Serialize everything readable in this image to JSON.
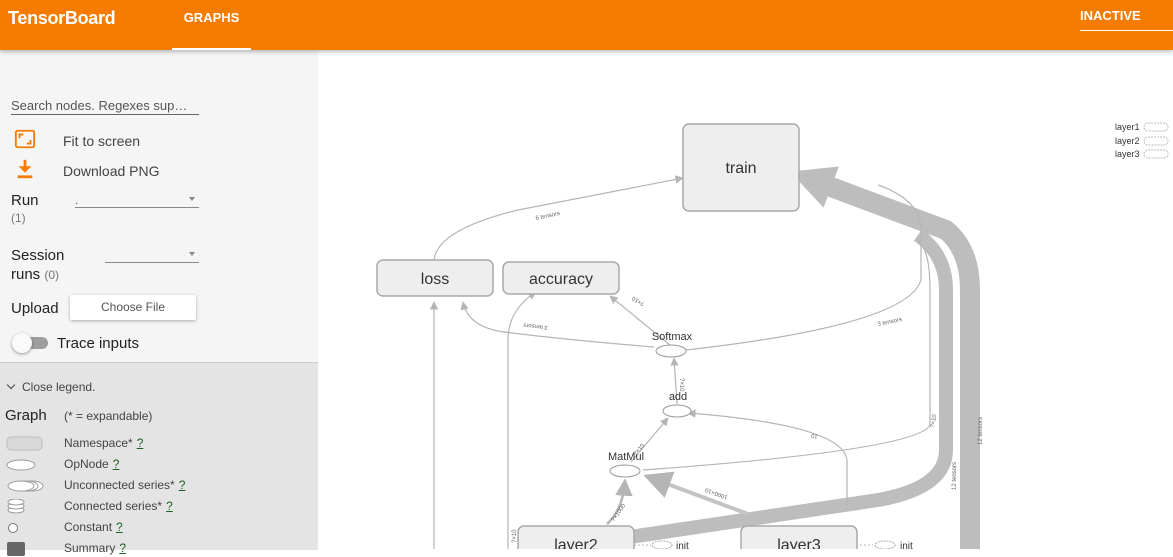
{
  "header": {
    "brand": "TensorBoard",
    "tab": "GRAPHS",
    "status": "INACTIVE",
    "color": "#f57c00"
  },
  "sidebar": {
    "search_placeholder": "Search nodes. Regexes sup…",
    "fit_label": "Fit to screen",
    "download_label": "Download PNG",
    "run_label": "Run",
    "run_count": "(1)",
    "run_value": ".",
    "session_label_1": "Session",
    "session_label_2": "runs",
    "session_count": "(0)",
    "upload_label": "Upload",
    "choose_file": "Choose File",
    "trace_label": "Trace inputs"
  },
  "legend": {
    "toggle": "Close legend.",
    "graph": "Graph",
    "expandable": "(* = expandable)",
    "help": "?",
    "items": [
      "Namespace*",
      "OpNode",
      "Unconnected series*",
      "Connected series*",
      "Constant",
      "Summary"
    ]
  },
  "graph": {
    "nodes": {
      "train": "train",
      "loss": "loss",
      "accuracy": "accuracy",
      "softmax": "Softmax",
      "add": "add",
      "matmul": "MatMul",
      "layer2": "layer2",
      "layer3": "layer3",
      "init1": "init",
      "init2": "init"
    },
    "edges": {
      "loss_train": "6 tensors",
      "softmax_loss": "3 tensors",
      "softmax_train": "3 tensors",
      "softmax_acc": "?×10",
      "add_softmax": "?×10",
      "matmul_add": "?×10",
      "layer3_add": "10",
      "layer3_matmul": "1000×10",
      "layer2_matmul": "?×1000",
      "train_side": "?×10",
      "tensors12": "12 tensors",
      "tensors12b": "12 tensors",
      "acc_left": "?×10"
    },
    "minimap": [
      "layer1",
      "layer2",
      "layer3"
    ]
  }
}
